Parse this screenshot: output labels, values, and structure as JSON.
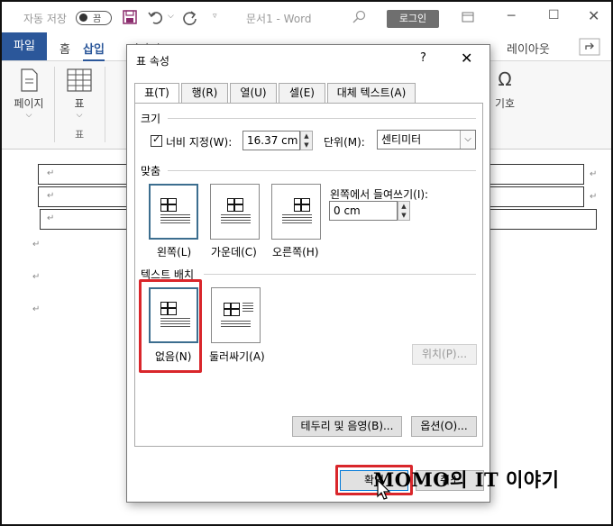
{
  "titlebar": {
    "autosave_label": "자동 저장",
    "autosave_state": "끔",
    "doc_title": "문서1  -  Word",
    "login_label": "로그인"
  },
  "ribbon": {
    "file_tab": "파일",
    "tabs": [
      "홈",
      "삽입",
      "디자인",
      "레이아웃"
    ],
    "group_page": "페이지",
    "group_table": "표",
    "group_table_label": "표",
    "symbol_label": "기호"
  },
  "dialog": {
    "title": "표 속성",
    "help": "?",
    "tabs": [
      "표(T)",
      "행(R)",
      "열(U)",
      "셀(E)",
      "대체 텍스트(A)"
    ],
    "size": {
      "section": "크기",
      "width_label": "너비 지정(W):",
      "width_value": "16.37 cm",
      "unit_label": "단위(M):",
      "unit_value": "센티미터"
    },
    "alignment": {
      "section": "맞춤",
      "left": "왼쪽(L)",
      "center": "가운데(C)",
      "right": "오른쪽(H)",
      "indent_label": "왼쪽에서 들여쓰기(I):",
      "indent_value": "0 cm"
    },
    "wrapping": {
      "section": "텍스트 배치",
      "none": "없음(N)",
      "around": "둘러싸기(A)",
      "position_button": "위치(P)..."
    },
    "buttons": {
      "borders": "테두리 및 음영(B)...",
      "options": "옵션(O)...",
      "ok": "확인",
      "cancel": "취소"
    }
  },
  "watermark": "MOMO의 IT 이야기",
  "colors": {
    "ribbon_blue": "#2b579a",
    "highlight_red": "#d9262b",
    "selected_border": "#3c6e8f"
  }
}
